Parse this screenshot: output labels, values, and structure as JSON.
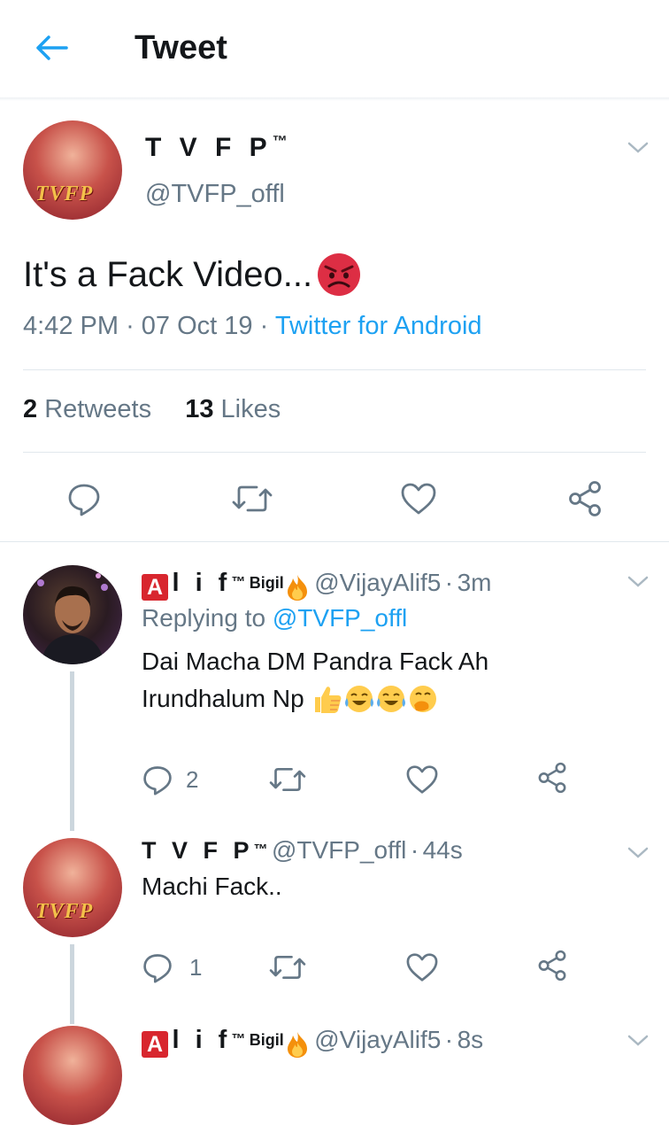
{
  "header": {
    "title": "Tweet"
  },
  "colors": {
    "accent": "#1da1f2",
    "secondary_text": "#657786",
    "divider": "#e1e8ed",
    "angry_face": "#dd2e44"
  },
  "main_tweet": {
    "author_name": "T V F P",
    "author_tm": "™",
    "author_handle": "@TVFP_offl",
    "avatar_text": "TVFP",
    "text": "It's a Fack Video...",
    "emoji": "angry-face",
    "time": "4:42 PM",
    "separator": "·",
    "date": "07 Oct 19",
    "source": "Twitter for Android",
    "retweets_count": "2",
    "retweets_label": "Retweets",
    "likes_count": "13",
    "likes_label": "Likes"
  },
  "replies": [
    {
      "badge": "A",
      "name": "l i f",
      "tm": "™",
      "bigil": "Bigil",
      "emoji": "fire",
      "handle": "@VijayAlif5",
      "separator": "·",
      "time": "3m",
      "replying_label": "Replying to",
      "replying_to": "@TVFP_offl",
      "text_line1": "Dai Macha DM Pandra Fack Ah",
      "text_line2": "Irundhalum Np",
      "emojis": [
        "thumbs-up",
        "face-with-tears-of-joy",
        "face-with-tears-of-joy",
        "face-with-hand-over-mouth"
      ],
      "reply_count": "2"
    },
    {
      "name": "T V F P",
      "tm": "™",
      "handle": "@TVFP_offl",
      "separator": "·",
      "time": "44s",
      "text": "Machi Fack..",
      "reply_count": "1",
      "avatar_text": "TVFP"
    },
    {
      "badge": "A",
      "name": "l i f",
      "tm": "™",
      "bigil": "Bigil",
      "emoji": "fire",
      "handle": "@VijayAlif5",
      "separator": "·",
      "time": "8s"
    }
  ]
}
